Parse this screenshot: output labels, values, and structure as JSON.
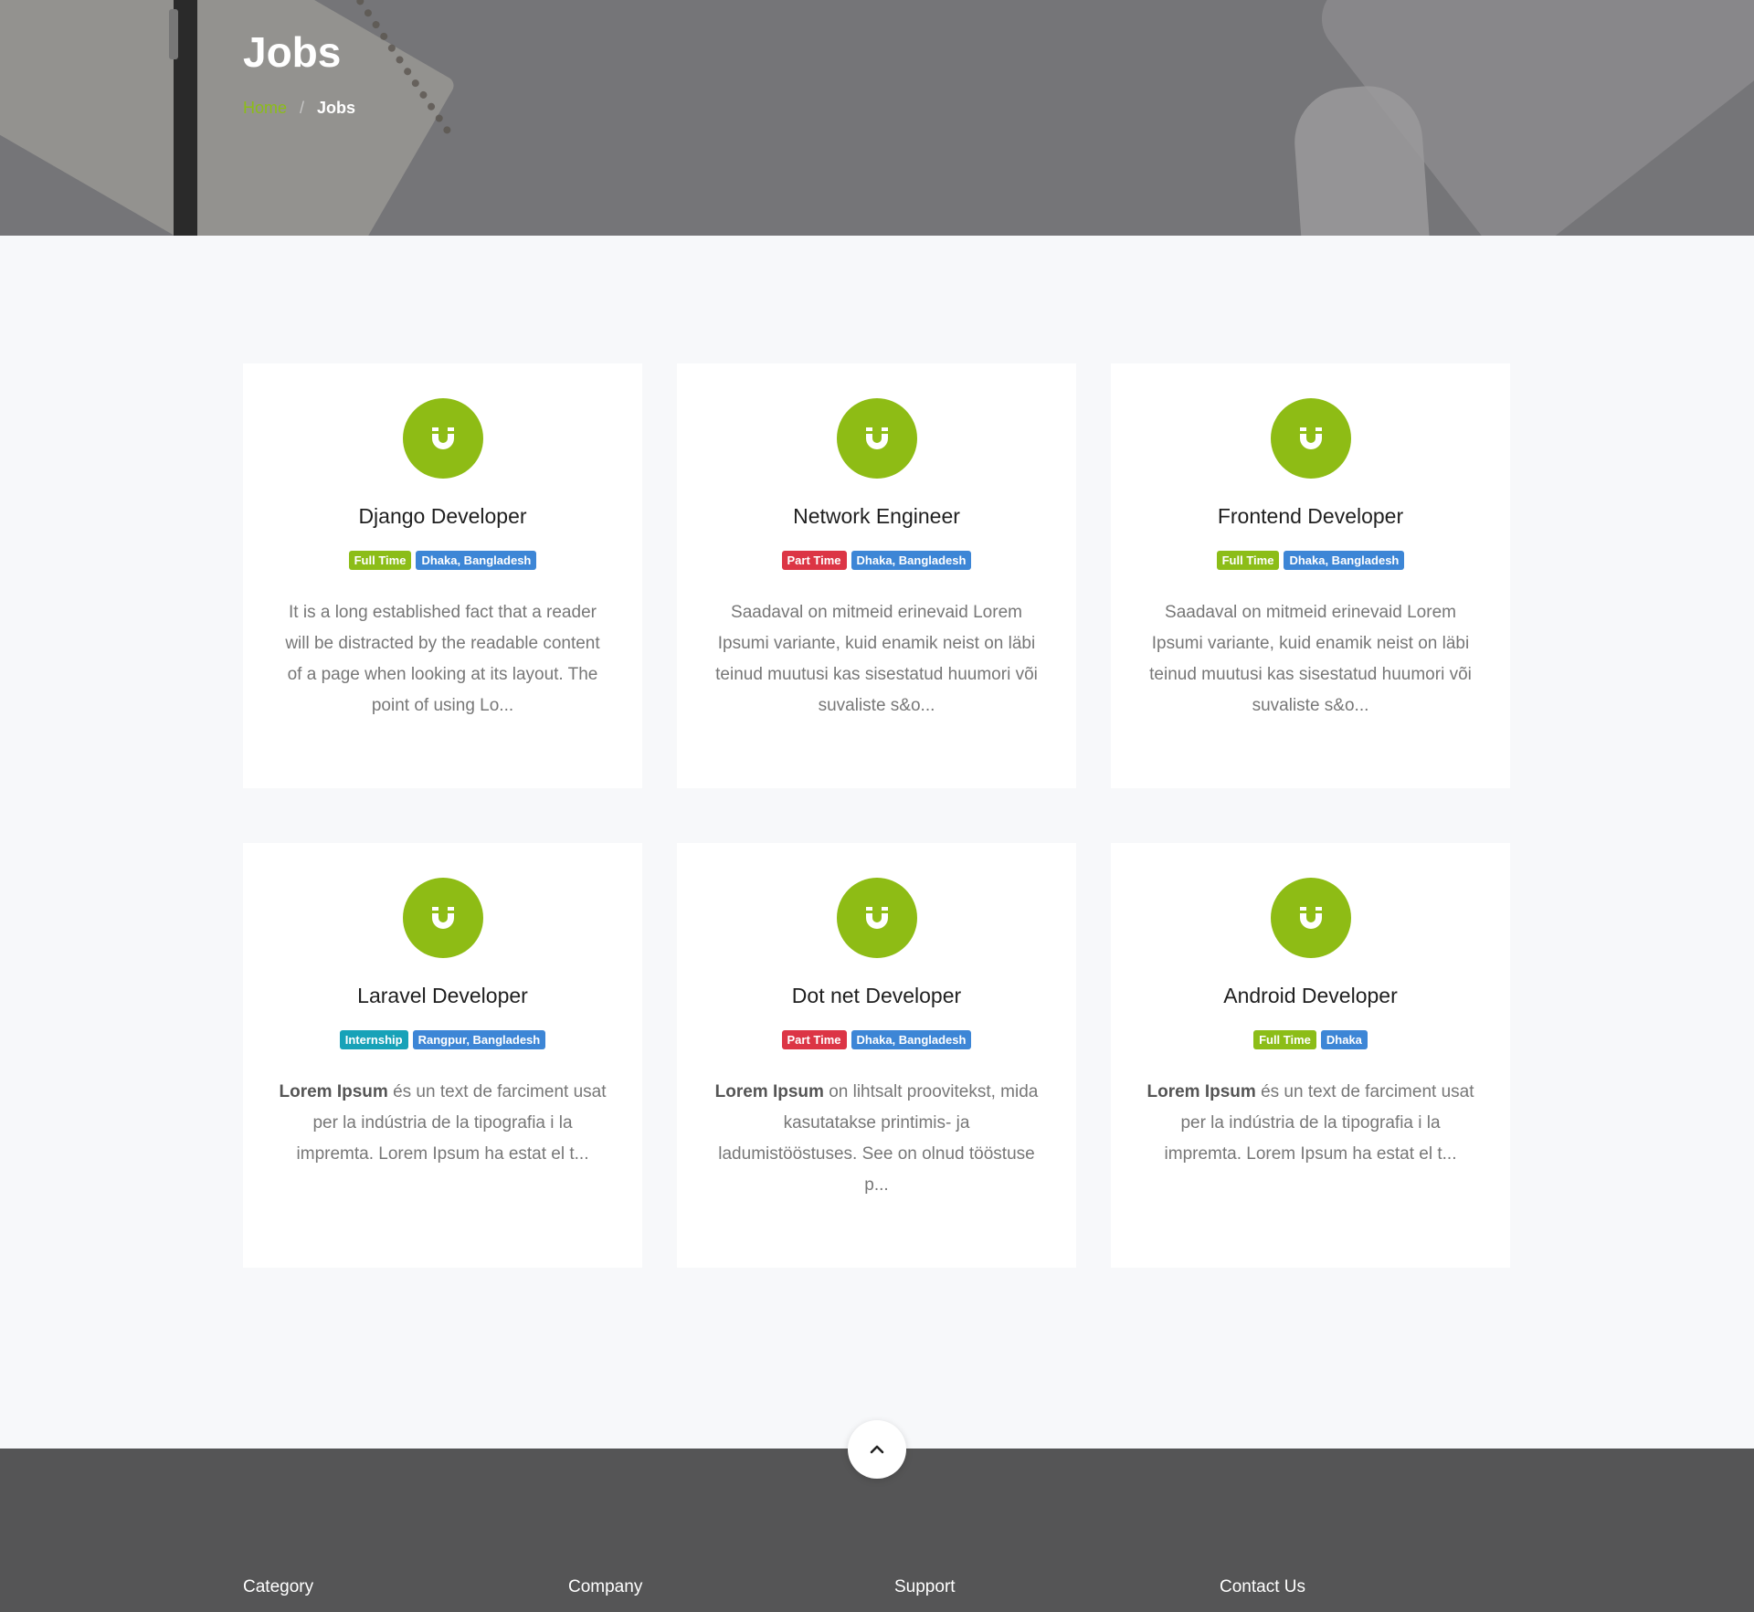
{
  "hero": {
    "title": "Jobs",
    "breadcrumb": {
      "home": "Home",
      "separator": "/",
      "current": "Jobs"
    }
  },
  "colors": {
    "accent": "#8cbd18",
    "full_time": "#8cbd18",
    "part_time": "#dc3545",
    "internship": "#17a2b8",
    "location": "#3d86d6",
    "footer_bg": "#555556"
  },
  "jobs": [
    {
      "title": "Django Developer",
      "type": "Full Time",
      "location": "Dhaka, Bangladesh",
      "desc_bold": "",
      "desc": "It is a long established fact that a reader will be distracted by the readable content of a page when looking at its layout. The point of using Lo..."
    },
    {
      "title": "Network Engineer",
      "type": "Part Time",
      "location": "Dhaka, Bangladesh",
      "desc_bold": "",
      "desc": "Saadaval on mitmeid erinevaid Lorem Ipsumi variante, kuid enamik neist on läbi teinud muutusi kas sisestatud huumori või suvaliste s&o..."
    },
    {
      "title": "Frontend Developer",
      "type": "Full Time",
      "location": "Dhaka, Bangladesh",
      "desc_bold": "",
      "desc": "Saadaval on mitmeid erinevaid Lorem Ipsumi variante, kuid enamik neist on läbi teinud muutusi kas sisestatud huumori või suvaliste s&o..."
    },
    {
      "title": "Laravel Developer",
      "type": "Internship",
      "location": "Rangpur, Bangladesh",
      "desc_bold": "Lorem Ipsum",
      "desc": " és un text de farciment usat per la indústria de la tipografia i la impremta. Lorem Ipsum ha estat el t..."
    },
    {
      "title": "Dot net Developer",
      "type": "Part Time",
      "location": "Dhaka, Bangladesh",
      "desc_bold": "Lorem Ipsum",
      "desc": " on lihtsalt proovitekst, mida kasutatakse printimis- ja ladumistööstuses. See on olnud tööstuse p..."
    },
    {
      "title": "Android Developer",
      "type": "Full Time",
      "location": "Dhaka",
      "desc_bold": "Lorem Ipsum",
      "desc": " és un text de farciment usat per la indústria de la tipografia i la impremta. Lorem Ipsum ha estat el t..."
    }
  ],
  "icons": {
    "company_logo": "magnet-icon",
    "back_to_top": "chevron-up-icon"
  },
  "footer": {
    "columns": [
      "Category",
      "Company",
      "Support",
      "Contact Us"
    ]
  }
}
